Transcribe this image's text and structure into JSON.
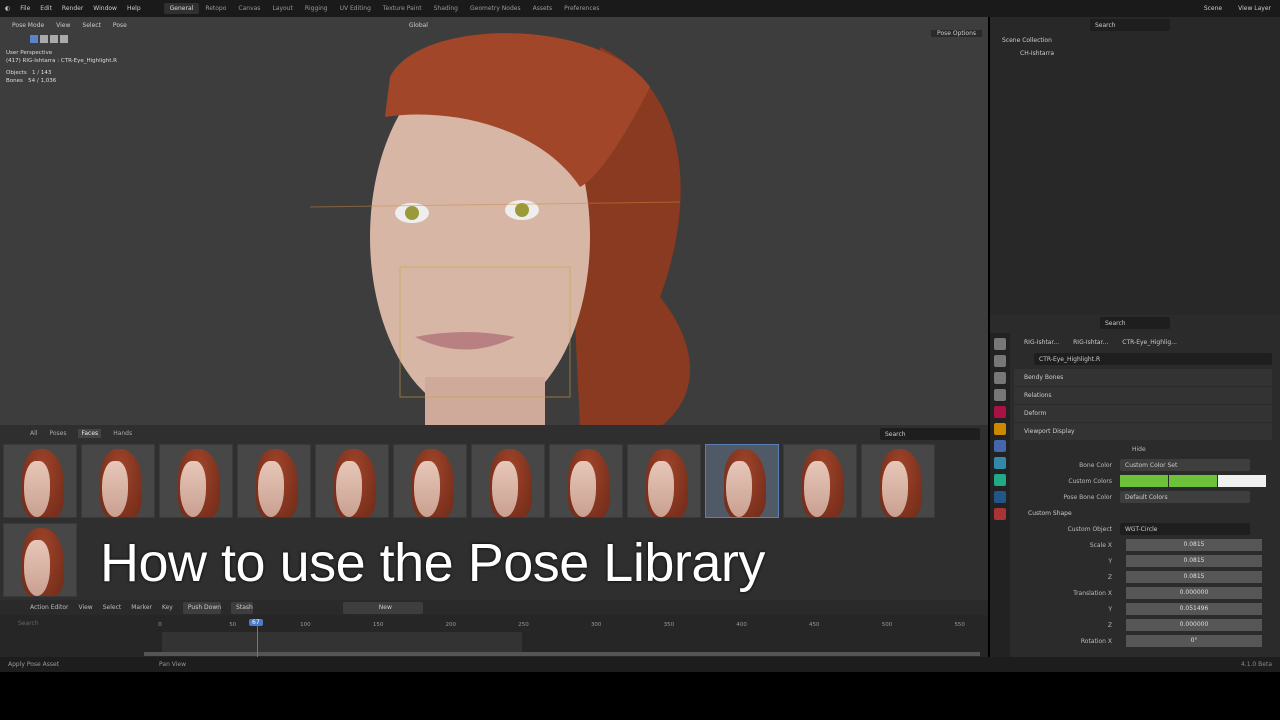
{
  "menu": [
    "File",
    "Edit",
    "Render",
    "Window",
    "Help"
  ],
  "workspaces": [
    "General",
    "Retopo",
    "Canvas",
    "Layout",
    "Rigging",
    "UV Editing",
    "Texture Paint",
    "Shading",
    "Geometry Nodes",
    "Assets",
    "Preferences"
  ],
  "scene": "Scene",
  "view_layer": "View Layer",
  "viewport": {
    "mode": "Pose Mode",
    "menus": [
      "View",
      "Select",
      "Pose"
    ],
    "orientation": "Global",
    "pose_options": "Pose Options",
    "overlay": {
      "perspective": "User Perspective",
      "context": "(417) RIG-Ishtarra : CTR-Eye_Highlight.R",
      "objects_label": "Objects",
      "objects_value": "1 / 143",
      "bones_label": "Bones",
      "bones_value": "54 / 1,036"
    }
  },
  "outliner": {
    "search_placeholder": "Search",
    "root": "Scene Collection",
    "item": "CH-Ishtarra"
  },
  "properties": {
    "search_placeholder": "Search",
    "breadcrumb": [
      "RIG-Ishtar...",
      "RIG-Ishtar...",
      "CTR-Eye_Highlig..."
    ],
    "bone_name": "CTR-Eye_Highlight.R",
    "sections": [
      "Bendy Bones",
      "Relations",
      "Deform",
      "Viewport Display"
    ],
    "hide_label": "Hide",
    "bone_color_label": "Bone Color",
    "bone_color_value": "Custom Color Set",
    "custom_colors_label": "Custom Colors",
    "custom_colors": [
      "#6ec23a",
      "#6ec23a",
      "#f0f0f0"
    ],
    "pose_bone_color_label": "Pose Bone Color",
    "pose_bone_color_value": "Default Colors",
    "custom_shape": "Custom Shape",
    "custom_object_label": "Custom Object",
    "custom_object_value": "WGT-Circle",
    "fields": [
      {
        "label": "Scale X",
        "value": "0.0815"
      },
      {
        "label": "Y",
        "value": "0.0815"
      },
      {
        "label": "Z",
        "value": "0.0815"
      },
      {
        "label": "Translation X",
        "value": "0.000000"
      },
      {
        "label": "Y",
        "value": "0.051496"
      },
      {
        "label": "Z",
        "value": "0.000000"
      },
      {
        "label": "Rotation X",
        "value": "0°"
      }
    ]
  },
  "assets": {
    "tabs": [
      "All",
      "Poses",
      "Faces",
      "Hands"
    ],
    "active_tab": "Faces",
    "search_placeholder": "Search",
    "thumb_count": 13,
    "selected_index": 9
  },
  "title": "How to use the Pose Library",
  "timeline": {
    "editor": "Action Editor",
    "menus": [
      "View",
      "Select",
      "Marker",
      "Key"
    ],
    "push_down": "Push Down",
    "stash": "Stash",
    "new": "New",
    "search_placeholder": "Search",
    "ticks": [
      "0",
      "50",
      "100",
      "150",
      "200",
      "250",
      "300",
      "350",
      "400",
      "450",
      "500",
      "550"
    ],
    "current_frame": "67"
  },
  "status": {
    "left": "Apply Pose Asset",
    "middle": "Pan View",
    "version": "4.1.0 Beta"
  }
}
